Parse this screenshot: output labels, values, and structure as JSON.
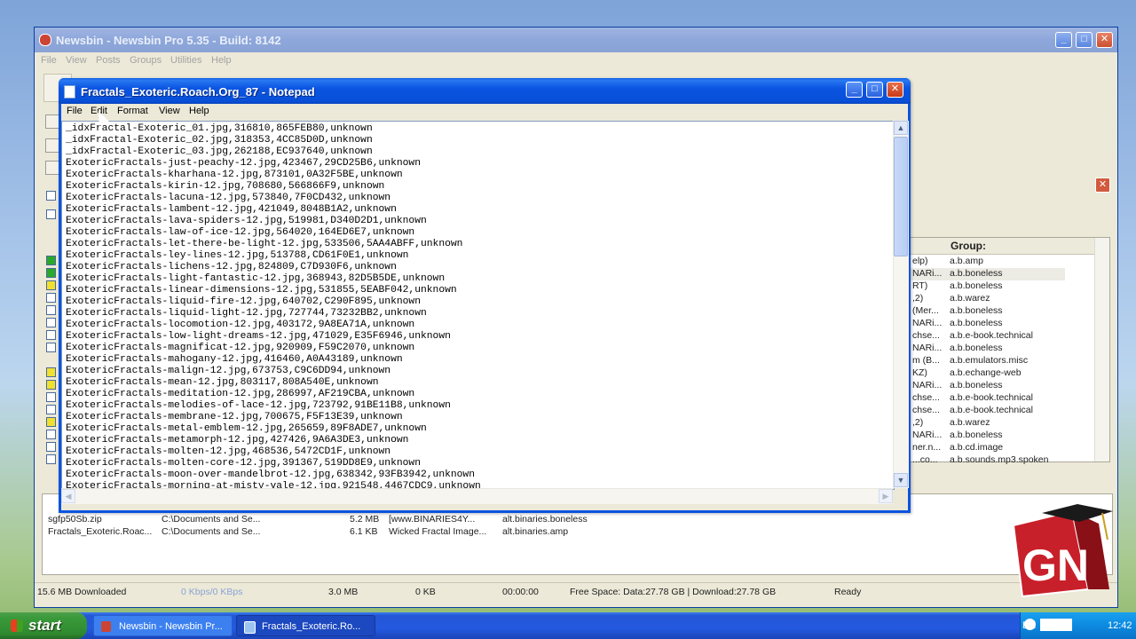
{
  "newsbin": {
    "title": "Newsbin - Newsbin Pro 5.35 - Build: 8142",
    "menu": [
      "File",
      "View",
      "Posts",
      "Groups",
      "Utilities",
      "Help"
    ],
    "group_header": "Group:",
    "groups": [
      {
        "left": "elp)",
        "group": "a.b.amp"
      },
      {
        "left": "NARi...",
        "group": "a.b.boneless"
      },
      {
        "left": "RT)",
        "group": "a.b.boneless"
      },
      {
        "left": ",2)",
        "group": "a.b.warez"
      },
      {
        "left": "(Mer...",
        "group": "a.b.boneless"
      },
      {
        "left": "NARi...",
        "group": "a.b.boneless"
      },
      {
        "left": "chse...",
        "group": "a.b.e-book.technical"
      },
      {
        "left": "NARi...",
        "group": "a.b.boneless"
      },
      {
        "left": "m (B...",
        "group": "a.b.emulators.misc"
      },
      {
        "left": "KZ)",
        "group": "a.b.echange-web"
      },
      {
        "left": "NARi...",
        "group": "a.b.boneless"
      },
      {
        "left": "chse...",
        "group": "a.b.e-book.technical"
      },
      {
        "left": "chse...",
        "group": "a.b.e-book.technical"
      },
      {
        "left": ",2)",
        "group": "a.b.warez"
      },
      {
        "left": "NARi...",
        "group": "a.b.boneless"
      },
      {
        "left": "ner.n...",
        "group": "a.b.cd.image"
      },
      {
        "left": "...co...",
        "group": "a.b.sounds.mp3.spoken"
      }
    ],
    "downloads": [
      {
        "name": "sgfp50Sb.zip",
        "path": "C:\\Documents and Se...",
        "size": "5.2 MB",
        "subject": "[www.BINARIES4Y...",
        "group": "alt.binaries.boneless"
      },
      {
        "name": "Fractals_Exoteric.Roac...",
        "path": "C:\\Documents and Se...",
        "size": "6.1 KB",
        "subject": "Wicked Fractal Image...",
        "group": "alt.binaries.amp"
      }
    ],
    "status": {
      "downloaded": "15.6 MB Downloaded",
      "speed": "0 Kbps/0 KBps",
      "queue_size": "3.0 MB",
      "queue_kb": "0 KB",
      "time": "00:00:00",
      "free_space": "Free Space: Data:27.78 GB | Download:27.78 GB",
      "state": "Ready"
    }
  },
  "notepad": {
    "title": "Fractals_Exoteric.Roach.Org_87 - Notepad",
    "menu": [
      "File",
      "Edit",
      "Format",
      "View",
      "Help"
    ],
    "lines": [
      "_idxFractal-Exoteric_01.jpg,316810,865FEB80,unknown",
      "_idxFractal-Exoteric_02.jpg,318353,4CC85D0D,unknown",
      "_idxFractal-Exoteric_03.jpg,262188,EC937640,unknown",
      "ExotericFractals-just-peachy-12.jpg,423467,29CD25B6,unknown",
      "ExotericFractals-kharhana-12.jpg,873101,0A32F5BE,unknown",
      "ExotericFractals-kirin-12.jpg,708680,566866F9,unknown",
      "ExotericFractals-lacuna-12.jpg,573840,7F0CD432,unknown",
      "ExotericFractals-lambent-12.jpg,421049,8048B1A2,unknown",
      "ExotericFractals-lava-spiders-12.jpg,519981,D340D2D1,unknown",
      "ExotericFractals-law-of-ice-12.jpg,564020,164ED6E7,unknown",
      "ExotericFractals-let-there-be-light-12.jpg,533506,5AA4ABFF,unknown",
      "ExotericFractals-ley-lines-12.jpg,513788,CD61F0E1,unknown",
      "ExotericFractals-lichens-12.jpg,824809,C7D930F6,unknown",
      "ExotericFractals-light-fantastic-12.jpg,368943,82D5B5DE,unknown",
      "ExotericFractals-linear-dimensions-12.jpg,531855,5EABF042,unknown",
      "ExotericFractals-liquid-fire-12.jpg,640702,C290F895,unknown",
      "ExotericFractals-liquid-light-12.jpg,727744,73232BB2,unknown",
      "ExotericFractals-locomotion-12.jpg,403172,9A8EA71A,unknown",
      "ExotericFractals-low-light-dreams-12.jpg,471029,E35F6946,unknown",
      "ExotericFractals-magnificat-12.jpg,920909,F59C2070,unknown",
      "ExotericFractals-mahogany-12.jpg,416460,A0A43189,unknown",
      "ExotericFractals-malign-12.jpg,673753,C9C6DD94,unknown",
      "ExotericFractals-mean-12.jpg,803117,808A540E,unknown",
      "ExotericFractals-meditation-12.jpg,286997,AF219CBA,unknown",
      "ExotericFractals-melodies-of-lace-12.jpg,723792,91BE11B8,unknown",
      "ExotericFractals-membrane-12.jpg,700675,F5F13E39,unknown",
      "ExotericFractals-metal-emblem-12.jpg,265659,89F8ADE7,unknown",
      "ExotericFractals-metamorph-12.jpg,427426,9A6A3DE3,unknown",
      "ExotericFractals-molten-12.jpg,468536,5472CD1F,unknown",
      "ExotericFractals-molten-core-12.jpg,391367,519DD8E9,unknown",
      "ExotericFractals-moon-over-mandelbrot-12.jpg,638342,93FB3942,unknown",
      "ExotericFractals-morning-at-misty-vale-12.jpg,921548,4467CDC9,unknown"
    ]
  },
  "taskbar": {
    "start_label": "start",
    "items": [
      "Newsbin - Newsbin Pr...",
      "Fractals_Exoteric.Ro..."
    ],
    "language": "EN",
    "clock": "12:42"
  },
  "logo_text": "GN"
}
